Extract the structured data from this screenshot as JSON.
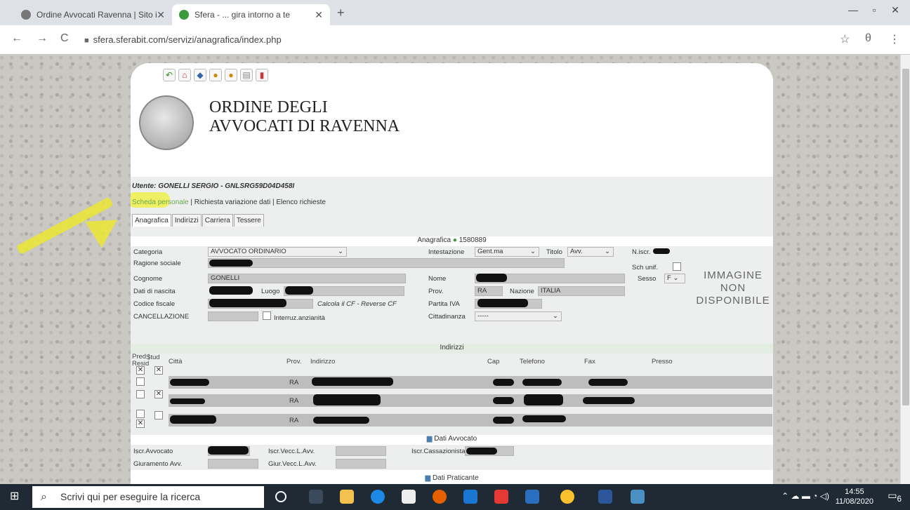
{
  "browser": {
    "tabs": [
      {
        "title": "Ordine Avvocati Ravenna | Sito i",
        "active": false
      },
      {
        "title": "Sfera - ... gira intorno a te",
        "active": true
      }
    ],
    "url": "sfera.sferabit.com/servizi/anagrafica/index.php",
    "new_tab": "+",
    "back": "←",
    "forward": "→",
    "reload": "C",
    "star": "☆",
    "account": "θ",
    "menu": "⋮",
    "win_min": "—",
    "win_max": "▫",
    "win_close": "✕"
  },
  "site": {
    "org_title_1": "ORDINE DEGLI",
    "org_title_2": "AVVOCATI DI RAVENNA",
    "user": "Utente: GONELLI SERGIO - GNLSRG59D04D458I",
    "link_personal": "Scheda personale",
    "link_rest": " | Richiesta variazione dati | Elenco richieste",
    "tabs": [
      "Anagrafica",
      "Indirizzi",
      "Carriera",
      "Tessere"
    ]
  },
  "anagrafica": {
    "header": "Anagrafica",
    "id": "1580889",
    "categoria_label": "Categoria",
    "categoria": "AVVOCATO ORDINARIO",
    "intestazione_label": "Intestazione",
    "intestazione": "Gent.ma",
    "titolo_label": "Titolo",
    "titolo": "Avv.",
    "niscr_label": "N.iscr.",
    "ragione_label": "Ragione sociale",
    "sch_unif_label": "Sch unif.",
    "cognome_label": "Cognome",
    "cognome": "GONELLI",
    "nome_label": "Nome",
    "sesso_label": "Sesso",
    "sesso": "F",
    "nascita_label": "Dati di nascita",
    "luogo_label": "Luogo",
    "prov_label": "Prov.",
    "prov": "RA",
    "nazione_label": "Nazione",
    "nazione": "ITALIA",
    "cf_label": "Codice fiscale",
    "cf_links": "Calcola il CF - Reverse CF",
    "piva_label": "Partita IVA",
    "cancellazione_label": "CANCELLAZIONE",
    "interruz_label": "Interruz.anzianità",
    "cittadinanza_label": "Cittadinanza",
    "cittadinanza": "-----",
    "no_image": [
      "IMMAGINE",
      "NON",
      "DISPONIBILE"
    ]
  },
  "indirizzi": {
    "header": "Indirizzi",
    "columns": [
      "Pred | Resid",
      "Stud",
      "Città",
      "Prov.",
      "Indirizzo",
      "Cap",
      "Telefono",
      "Fax",
      "Presso"
    ],
    "rows": [
      {
        "prov": "RA"
      },
      {
        "prov": "RA"
      },
      {
        "prov": "RA"
      }
    ]
  },
  "avvocato": {
    "header": "Dati Avvocato",
    "iscr_avv": "Iscr.Avvocato",
    "iscr_vecc": "Iscr.Vecc.L.Avv.",
    "iscr_cass": "Iscr.Cassazionista",
    "giuramento": "Giuramento Avv.",
    "giur_vecc": "Giur.Vecc.L.Avv."
  },
  "praticante": {
    "header": "Dati Praticante"
  },
  "taskbar": {
    "search": "Scrivi qui per eseguire la ricerca",
    "time": "14:55",
    "date": "11/08/2020",
    "notif_count": "6"
  },
  "colors": {
    "highlight": "#f0f028",
    "section": "#e4ede2",
    "taskbar": "#1f2a35"
  }
}
